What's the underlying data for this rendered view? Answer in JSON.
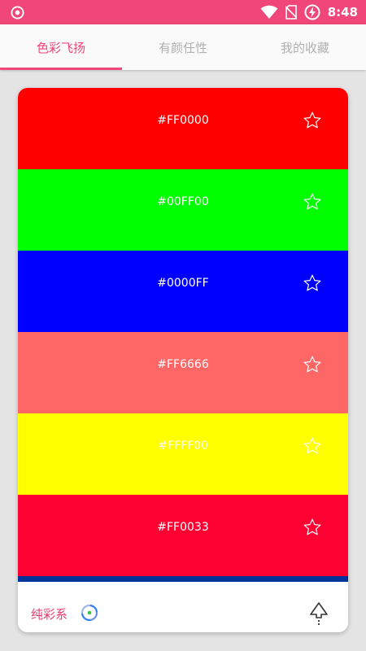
{
  "status_bar": {
    "time": "8:48",
    "icons": [
      "record-icon",
      "wifi-icon",
      "no-sim-icon",
      "battery-charging-icon"
    ]
  },
  "tabs": [
    {
      "label": "色彩飞扬",
      "active": true
    },
    {
      "label": "有颜任性",
      "active": false
    },
    {
      "label": "我的收藏",
      "active": false
    }
  ],
  "swatches": [
    {
      "hex": "#FF0000",
      "color": "#FF0000",
      "text_color": "#ffffff"
    },
    {
      "hex": "#00FF00",
      "color": "#00FF00",
      "text_color": "#ffffff"
    },
    {
      "hex": "#0000FF",
      "color": "#0000FF",
      "text_color": "#ffffff"
    },
    {
      "hex": "#FF6666",
      "color": "#FF6666",
      "text_color": "#ffffff"
    },
    {
      "hex": "#FFFF00",
      "color": "#FFFF00",
      "text_color": "#ffffff"
    },
    {
      "hex": "#FF0033",
      "color": "#FF0033",
      "text_color": "#ffffff"
    },
    {
      "hex": "",
      "color": "#003399",
      "text_color": "#ffffff"
    }
  ],
  "footer": {
    "label": "纯彩系",
    "icons": [
      "loading-spinner-icon",
      "share-icon"
    ]
  },
  "colors": {
    "accent": "#f0467a",
    "background": "#e4e4e4",
    "tab_inactive": "#b0b0b0"
  }
}
